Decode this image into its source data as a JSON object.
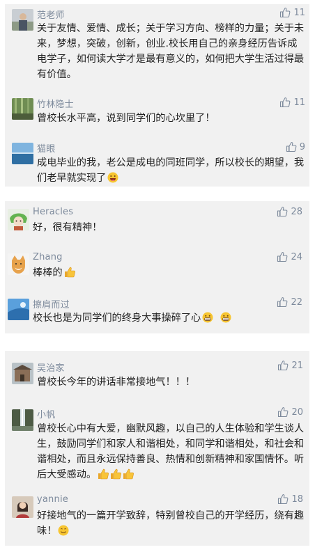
{
  "groups": [
    {
      "comments": [
        {
          "name": "范老师",
          "likes": "11",
          "text": "关于友情、爱情、成长；关于学习方向、榜样的力量；关于未来，梦想，突破，创新，创业.校长用自己的亲身经历告诉成电学子，如何读大学才是最有意义的，如何把大学生活过得最有价值。",
          "avatar": "man-outdoor-avatar"
        },
        {
          "name": "竹林隐士",
          "likes": "11",
          "text": "曾校长水平高，说到同学们的心坎里了！",
          "avatar": "bamboo-avatar"
        },
        {
          "name": "猫眼",
          "likes": "9",
          "text": "成电毕业的我，老公是成电的同班同学，所以校长的期望，我们老早就实现了",
          "emoji": [
            "grin-emoji"
          ],
          "avatar": "sea-avatar"
        }
      ]
    },
    {
      "comments": [
        {
          "name": "Heracles",
          "likes": "28",
          "text": "好，很有精神！",
          "avatar": "anime-avatar"
        },
        {
          "name": "Zhang",
          "likes": "24",
          "text": "棒棒的",
          "emoji": [
            "thumbs-up-emoji"
          ],
          "avatar": "fox-avatar"
        },
        {
          "name": "擦肩而过",
          "likes": "22",
          "text": "校长也是为同学们的终身大事操碎了心",
          "emoji": [
            "grimace-emoji",
            "grimace-emoji"
          ],
          "avatar": "sky-avatar"
        }
      ]
    },
    {
      "comments": [
        {
          "name": "吴治家",
          "likes": "21",
          "text": "曾校长今年的讲话非常接地气！！！",
          "avatar": "building-avatar"
        },
        {
          "name": "小帆",
          "likes": "20",
          "text": "曾校长心中有大爱，幽默风趣，以自己的人生体验和学生谈人生，鼓励同学们和家人和谐相处，和同学和谐相处，和社会和谐相处，而且永远保持善良、热情和创新精神和家国情怀。听后大受感动。",
          "emoji": [
            "thumbs-up-emoji",
            "thumbs-up-emoji",
            "thumbs-up-emoji"
          ],
          "avatar": "waterfall-avatar"
        },
        {
          "name": "yannie",
          "likes": "18",
          "text": "好接地气的一篇开学致辞，特别曾校自己的开学经历，绕有趣味！",
          "emoji": [
            "smile-emoji"
          ],
          "avatar": "woman-avatar"
        }
      ]
    }
  ],
  "colors": {
    "card": "#f1f1f1",
    "name": "#7d8a9c",
    "text": "#222222"
  }
}
